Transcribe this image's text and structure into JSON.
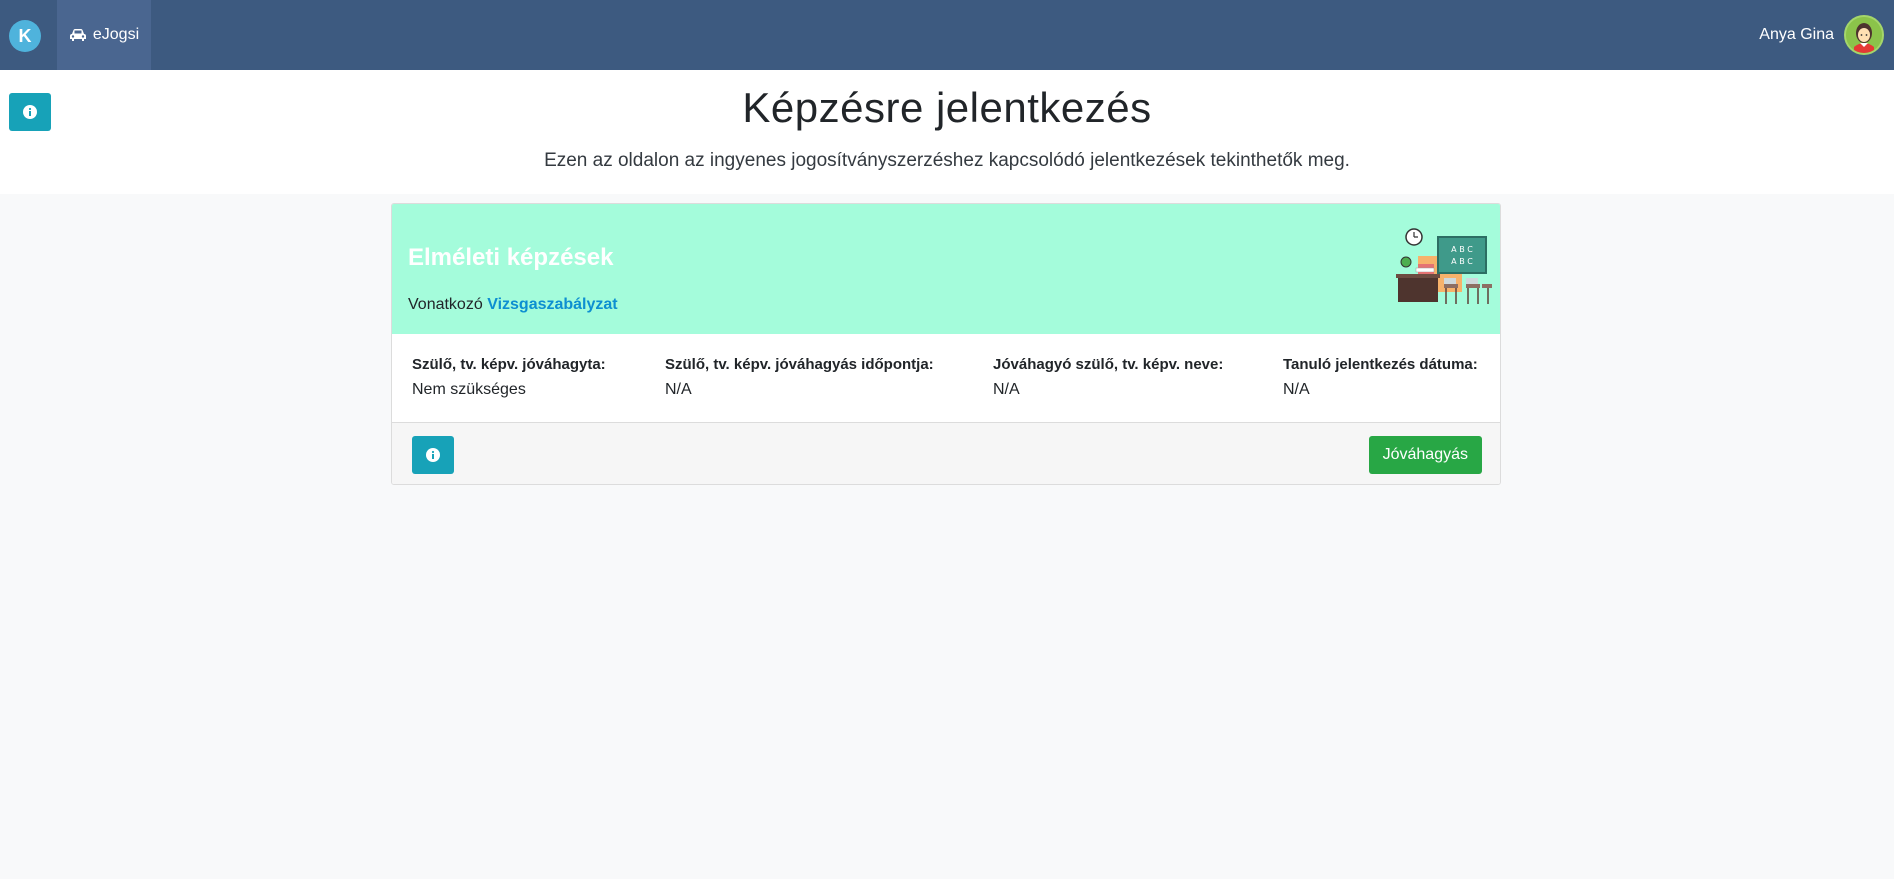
{
  "navbar": {
    "logo_letter": "K",
    "nav_item_label": "eJogsi",
    "user_name": "Anya Gina"
  },
  "header": {
    "title": "Képzésre jelentkezés",
    "subtitle": "Ezen az oldalon az ingyenes jogosítványszerzéshez kapcsolódó jelentkezések tekinthetők meg."
  },
  "card": {
    "title": "Elméleti képzések",
    "ref_prefix": "Vonatkozó",
    "ref_link": "Vizsgaszabályzat",
    "fields": [
      {
        "label": "Szülő, tv. képv. jóváhagyta:",
        "value": "Nem szükséges"
      },
      {
        "label": "Szülő, tv. képv. jóváhagyás időpontja:",
        "value": "N/A"
      },
      {
        "label": "Jóváhagyó szülő, tv. képv. neve:",
        "value": "N/A"
      },
      {
        "label": "Tanuló jelentkezés dátuma:",
        "value": "N/A"
      }
    ],
    "approve_label": "Jóváhagyás"
  },
  "colors": {
    "navbar": "#3d5a80",
    "card_header": "#a4fcdb",
    "info_button": "#17a2b8",
    "approve_button": "#28a745"
  }
}
